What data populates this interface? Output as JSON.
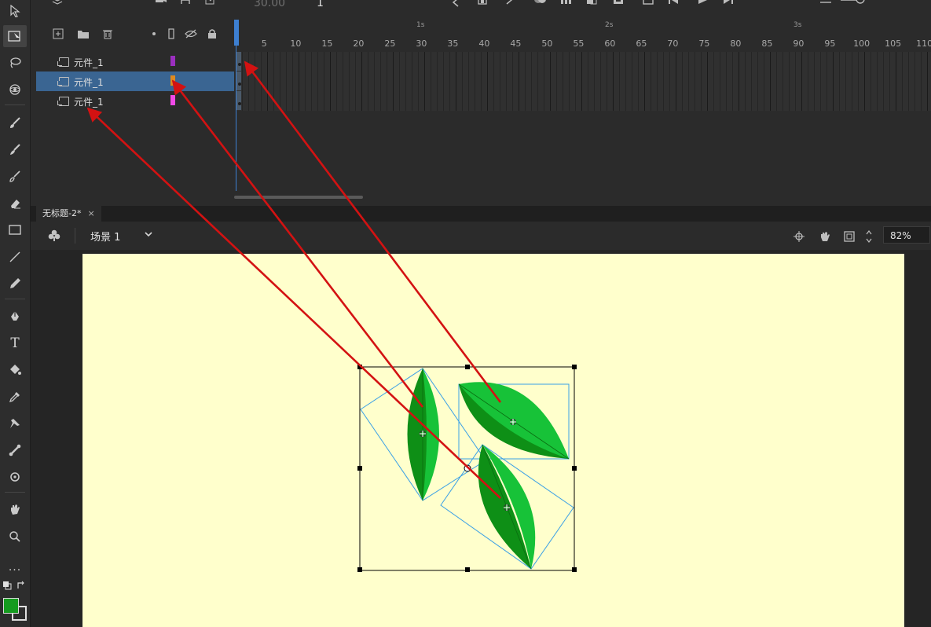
{
  "app": {
    "tools": [
      {
        "name": "selection-tool",
        "label": "Selection"
      },
      {
        "name": "free-transform-tool",
        "label": "Free Transform"
      },
      {
        "name": "lasso-tool",
        "label": "Lasso"
      },
      {
        "name": "3d-rotation-tool",
        "label": "3D Rotation"
      },
      {
        "name": "brush-tool",
        "label": "Brush"
      },
      {
        "name": "paint-brush-tool",
        "label": "Paint Brush"
      },
      {
        "name": "fluid-brush-tool",
        "label": "Fluid Brush"
      },
      {
        "name": "eraser-tool",
        "label": "Eraser"
      },
      {
        "name": "rectangle-tool",
        "label": "Rectangle"
      },
      {
        "name": "line-tool",
        "label": "Line"
      },
      {
        "name": "pencil-tool",
        "label": "Pencil"
      },
      {
        "name": "pen-tool",
        "label": "Pen"
      },
      {
        "name": "text-tool",
        "label": "T"
      },
      {
        "name": "paint-bucket-tool",
        "label": "Paint Bucket"
      },
      {
        "name": "eyedropper-tool",
        "label": "Eyedropper"
      },
      {
        "name": "pin-tool",
        "label": "Pin"
      },
      {
        "name": "bone-tool",
        "label": "Bone"
      },
      {
        "name": "camera-tool",
        "label": "Camera"
      },
      {
        "name": "hand-tool",
        "label": "Hand"
      },
      {
        "name": "zoom-tool",
        "label": "Zoom"
      },
      {
        "name": "more-tools",
        "label": "..."
      }
    ],
    "fill_color": "#159b1f",
    "stroke_color": "#e0e0e0"
  },
  "timeline": {
    "fps": "30.00",
    "current_frame": "1",
    "seconds_labels": [
      "1s",
      "2s",
      "3s"
    ],
    "frame_numbers": [
      "5",
      "10",
      "15",
      "20",
      "25",
      "30",
      "35",
      "40",
      "45",
      "50",
      "55",
      "60",
      "65",
      "70",
      "75",
      "80",
      "85",
      "90",
      "95",
      "100",
      "105",
      "110"
    ],
    "layers": [
      {
        "name": "元件_1",
        "color": "#9b2fbf",
        "selected": false
      },
      {
        "name": "元件_1",
        "color": "#e08a1e",
        "selected": true
      },
      {
        "name": "元件_1",
        "color": "#f24ae8",
        "selected": false
      }
    ]
  },
  "document": {
    "tab_title": "无标题-2*",
    "close_glyph": "×",
    "scene_label": "场景 1",
    "zoom": "82%",
    "stage_color": "#ffffcc"
  },
  "leaves": {
    "fill_dark": "#0e8f16",
    "fill_light": "#17c238",
    "bbox_color": "#3aa0e6",
    "arrow_color": "#d31212"
  }
}
